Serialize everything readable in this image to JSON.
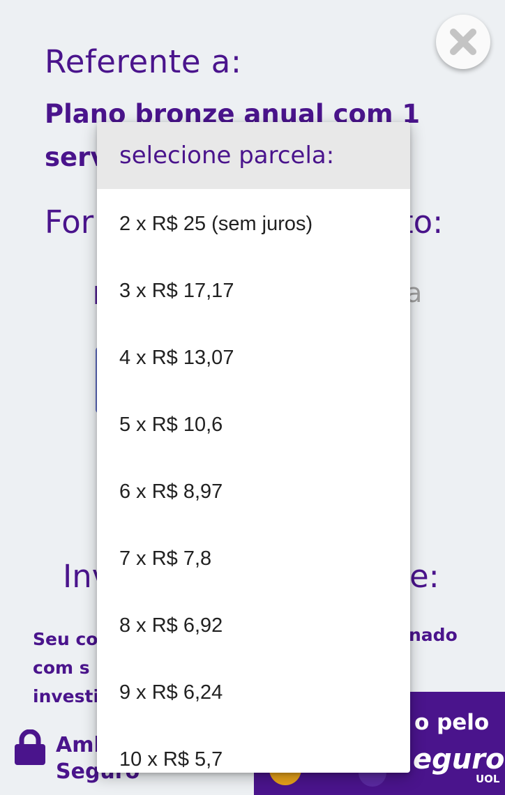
{
  "background": {
    "referente_heading": "Referente a:",
    "plan_line1": "Plano bronze anual com 1",
    "plan_line2_partial": "serv",
    "forma_heading_partial": "For",
    "forma_heading_end": "to:",
    "option_partial": "I",
    "option_partial_end": "a",
    "invest_heading_partial": "Inv",
    "invest_heading_end": "e:",
    "desc_line1_partial": "Seu co",
    "desc_line2_partial": "com s",
    "desc_line3_partial": "investi",
    "desc_line1_end": "nado",
    "secure_label_line1": "Amb",
    "secure_label_line2": "Seguro"
  },
  "banner": {
    "top_text": "o pelo",
    "brand_text": "eguro",
    "brand_small": "UOL"
  },
  "dropdown": {
    "header": "selecione parcela:",
    "options": [
      "2 x R$ 25 (sem juros)",
      "3 x R$ 17,17",
      "4 x R$ 13,07",
      "5 x R$ 10,6",
      "6 x R$ 8,97",
      "7 x R$ 7,8",
      "8 x R$ 6,92",
      "9 x R$ 6,24",
      "10 x R$ 5,7"
    ]
  },
  "icons": {
    "close": "close-icon",
    "lock": "lock-icon"
  },
  "colors": {
    "brand_purple": "#4a148c",
    "page_bg": "#edf0f3",
    "header_bg": "#e8e8e8"
  }
}
